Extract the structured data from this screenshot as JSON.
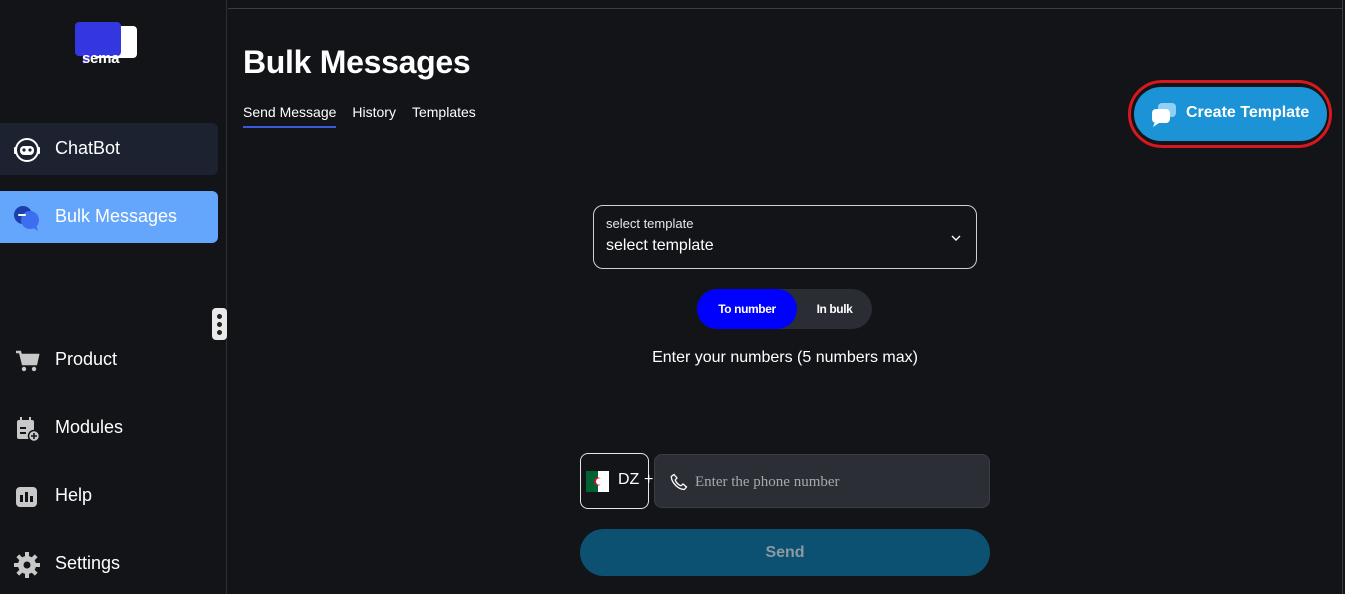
{
  "brand": {
    "name": "sema"
  },
  "sidebar": {
    "items": [
      {
        "label": "ChatBot",
        "icon": "chatbot-icon"
      },
      {
        "label": "Bulk Messages",
        "icon": "chat-bubbles-icon"
      },
      {
        "label": "Product",
        "icon": "cart-icon"
      },
      {
        "label": "Modules",
        "icon": "calendar-plus-icon"
      },
      {
        "label": "Help",
        "icon": "help-icon"
      },
      {
        "label": "Settings",
        "icon": "gear-icon"
      }
    ]
  },
  "header": {
    "title": "Bulk Messages",
    "tabs": [
      "Send Message",
      "History",
      "Templates"
    ],
    "create_button": "Create Template"
  },
  "form": {
    "template_select": {
      "label": "select template",
      "value": "select template"
    },
    "toggle": {
      "on": "To number",
      "off": "In bulk"
    },
    "hint": "Enter your numbers (5 numbers max)",
    "country_code": "DZ",
    "plus": "+",
    "phone_placeholder": "Enter the phone number",
    "send_label": "Send"
  },
  "colors": {
    "background": "#121418",
    "accent": "#63a6fb",
    "create_button": "#1b93d6",
    "toggle_on": "#0000ff",
    "send_button": "#0c5072",
    "highlight_ring": "#d9171f"
  }
}
